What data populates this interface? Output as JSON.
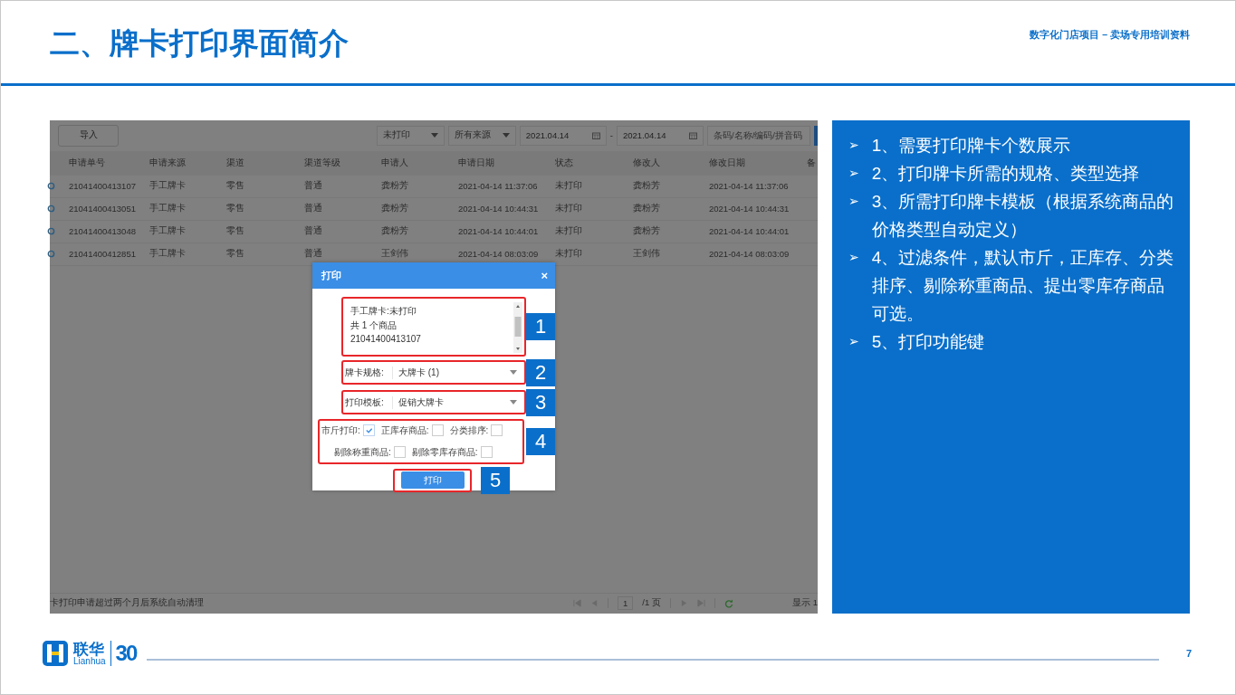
{
  "slide": {
    "title": "二、牌卡打印界面简介",
    "subtitle": "数字化门店项目 – 卖场专用培训资料",
    "page_number": "7"
  },
  "logo": {
    "name": "联华",
    "latin": "Lianhua",
    "anniversary": "30"
  },
  "screenshot": {
    "toolbar": {
      "import_button": "导入",
      "filters": [
        {
          "kind": "dropdown",
          "value": "未打印"
        },
        {
          "kind": "dropdown",
          "value": "所有来源"
        },
        {
          "kind": "date",
          "value": "2021.04.14"
        },
        {
          "kind": "separator",
          "value": "-"
        },
        {
          "kind": "date",
          "value": "2021.04.14"
        },
        {
          "kind": "search",
          "placeholder": "条码/名称/编码/拼音码"
        }
      ]
    },
    "table": {
      "columns": [
        "申请单号",
        "申请来源",
        "渠道",
        "渠道等级",
        "申请人",
        "申请日期",
        "状态",
        "修改人",
        "修改日期",
        "备"
      ],
      "rows": [
        [
          "21041400413107",
          "手工牌卡",
          "零售",
          "普通",
          "龚粉芳",
          "2021-04-14 11:37:06",
          "未打印",
          "龚粉芳",
          "2021-04-14 11:37:06"
        ],
        [
          "21041400413051",
          "手工牌卡",
          "零售",
          "普通",
          "龚粉芳",
          "2021-04-14 10:44:31",
          "未打印",
          "龚粉芳",
          "2021-04-14 10:44:31"
        ],
        [
          "21041400413048",
          "手工牌卡",
          "零售",
          "普通",
          "龚粉芳",
          "2021-04-14 10:44:01",
          "未打印",
          "龚粉芳",
          "2021-04-14 10:44:01"
        ],
        [
          "21041400412851",
          "手工牌卡",
          "零售",
          "普通",
          "王剑伟",
          "2021-04-14 08:03:09",
          "未打印",
          "王剑伟",
          "2021-04-14 08:03:09"
        ]
      ]
    },
    "footer": {
      "note": "卡打印申请超过两个月后系统自动清理",
      "page": "1",
      "page_total": "/1 页",
      "display": "显示 1"
    },
    "dialog": {
      "title": "打印",
      "close": "×",
      "summary": {
        "lines": [
          "手工牌卡:未打印",
          "共 1 个商品",
          "21041400413107"
        ],
        "callout": "1"
      },
      "selects": [
        {
          "label": "牌卡规格:",
          "value": "大牌卡 (1)",
          "callout": "2"
        },
        {
          "label": "打印模板:",
          "value": "促销大牌卡",
          "callout": "3"
        }
      ],
      "options": {
        "callout": "4",
        "items": [
          {
            "label": "市斤打印:",
            "checked": true
          },
          {
            "label": "正库存商品:",
            "checked": false
          },
          {
            "label": "分类排序:",
            "checked": false
          },
          {
            "label": "剔除称重商品:",
            "checked": false
          },
          {
            "label": "剔除零库存商品:",
            "checked": false
          }
        ]
      },
      "print_button": {
        "label": "打印",
        "callout": "5"
      }
    }
  },
  "notes": [
    "1、需要打印牌卡个数展示",
    "2、打印牌卡所需的规格、类型选择",
    "3、所需打印牌卡模板（根据系统商品的价格类型自动定义）",
    "4、过滤条件，默认市斤，正库存、分类排序、剔除称重商品、提出零库存商品可选。",
    "5、打印功能键"
  ],
  "bullet": "➢"
}
